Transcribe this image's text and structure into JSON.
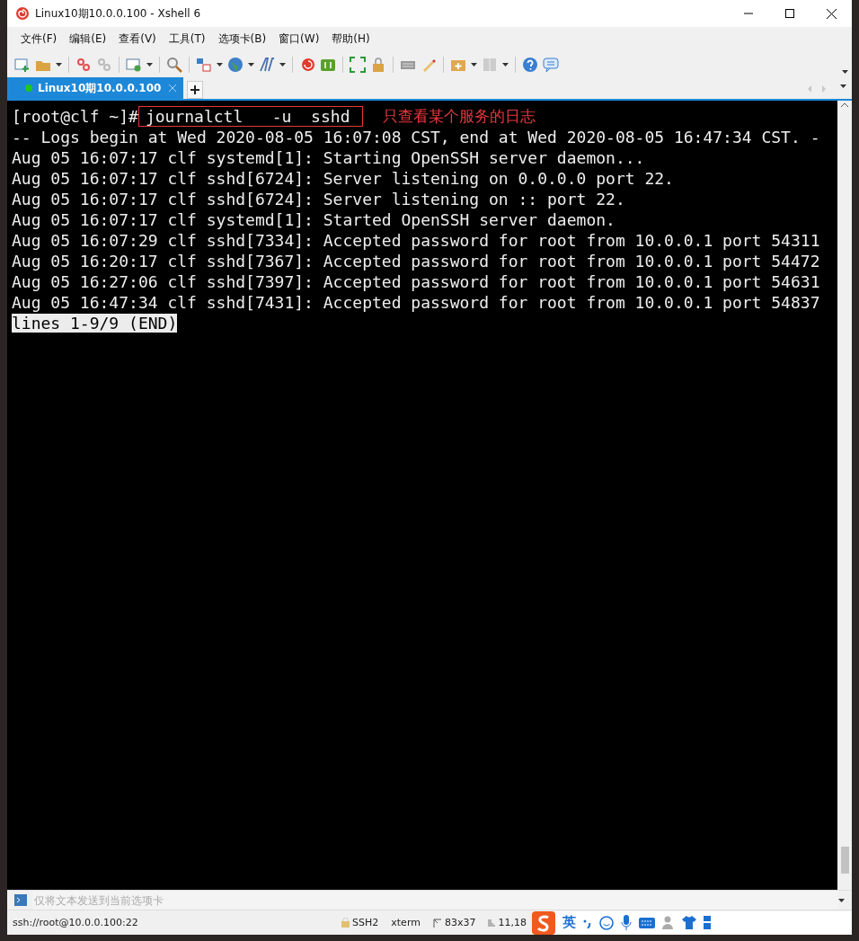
{
  "window": {
    "title": "Linux10期10.0.0.100 - Xshell 6"
  },
  "menu": [
    "文件(F)",
    "编辑(E)",
    "查看(V)",
    "工具(T)",
    "选项卡(B)",
    "窗口(W)",
    "帮助(H)"
  ],
  "tabs": [
    {
      "label": "Linux10期10.0.0.100",
      "selected": true,
      "connected": true
    }
  ],
  "terminal": {
    "prompt": "[root@clf ~]#",
    "command": "journalctl   -u  sshd",
    "annotation": "只查看某个服务的日志",
    "lines": [
      "-- Logs begin at Wed 2020-08-05 16:07:08 CST, end at Wed 2020-08-05 16:47:34 CST. -",
      "Aug 05 16:07:17 clf systemd[1]: Starting OpenSSH server daemon...",
      "Aug 05 16:07:17 clf sshd[6724]: Server listening on 0.0.0.0 port 22.",
      "Aug 05 16:07:17 clf sshd[6724]: Server listening on :: port 22.",
      "Aug 05 16:07:17 clf systemd[1]: Started OpenSSH server daemon.",
      "Aug 05 16:07:29 clf sshd[7334]: Accepted password for root from 10.0.0.1 port 54311",
      "Aug 05 16:20:17 clf sshd[7367]: Accepted password for root from 10.0.0.1 port 54472",
      "Aug 05 16:27:06 clf sshd[7397]: Accepted password for root from 10.0.0.1 port 54631",
      "Aug 05 16:47:34 clf sshd[7431]: Accepted password for root from 10.0.0.1 port 54837"
    ],
    "pager_status": "lines 1-9/9 (END)"
  },
  "send_bar": {
    "placeholder": "仅将文本发送到当前选项卡"
  },
  "status_bar": {
    "address": "ssh://root@10.0.0.100:22",
    "protocol": "SSH2",
    "terminal_type": "xterm",
    "size": "83x37",
    "cursor": "11,18"
  },
  "ime": {
    "mode": "英"
  }
}
